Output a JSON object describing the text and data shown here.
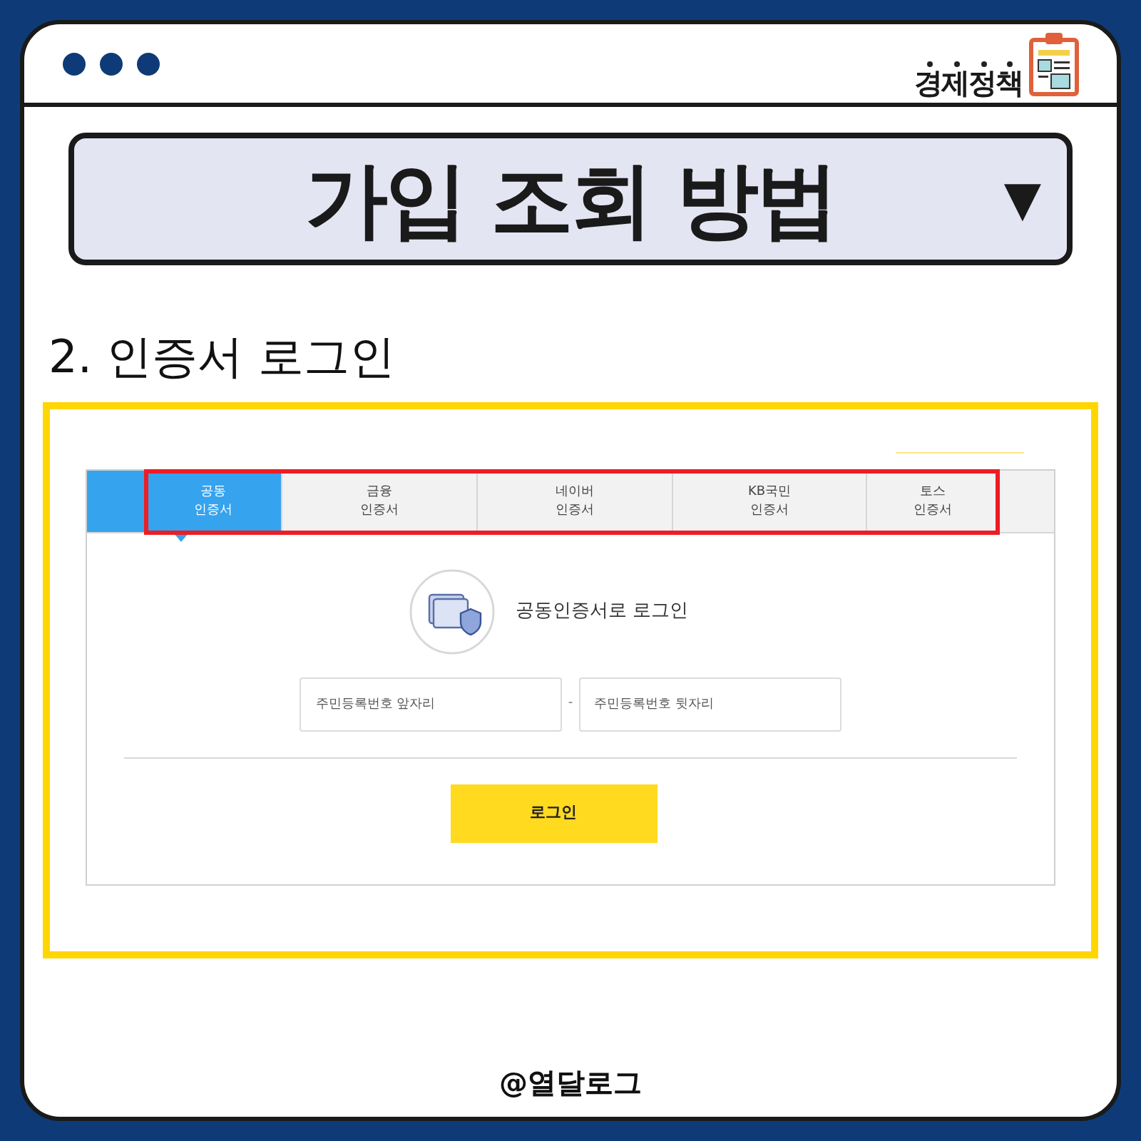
{
  "brand": {
    "logo_text": "경제정책"
  },
  "title_box": {
    "title": "가입 조회 방법",
    "arrow": "▼"
  },
  "subtitle": "2. 인증서 로그인",
  "login_panel": {
    "tabs": [
      {
        "lines": [
          "공동",
          "인증서"
        ],
        "selected": true
      },
      {
        "lines": [
          "금융",
          "인증서"
        ],
        "selected": false
      },
      {
        "lines": [
          "네이버",
          "인증서"
        ],
        "selected": false
      },
      {
        "lines": [
          "KB국민",
          "인증서"
        ],
        "selected": false
      },
      {
        "lines": [
          "토스",
          "인증서"
        ],
        "selected": false
      }
    ],
    "heading": "공동인증서로 로그인",
    "fields": [
      {
        "placeholder": "주민등록번호 앞자리"
      },
      {
        "placeholder": "주민등록번호 뒷자리"
      }
    ],
    "separator": "-",
    "button": "로그인"
  },
  "footer": "@열달로그"
}
